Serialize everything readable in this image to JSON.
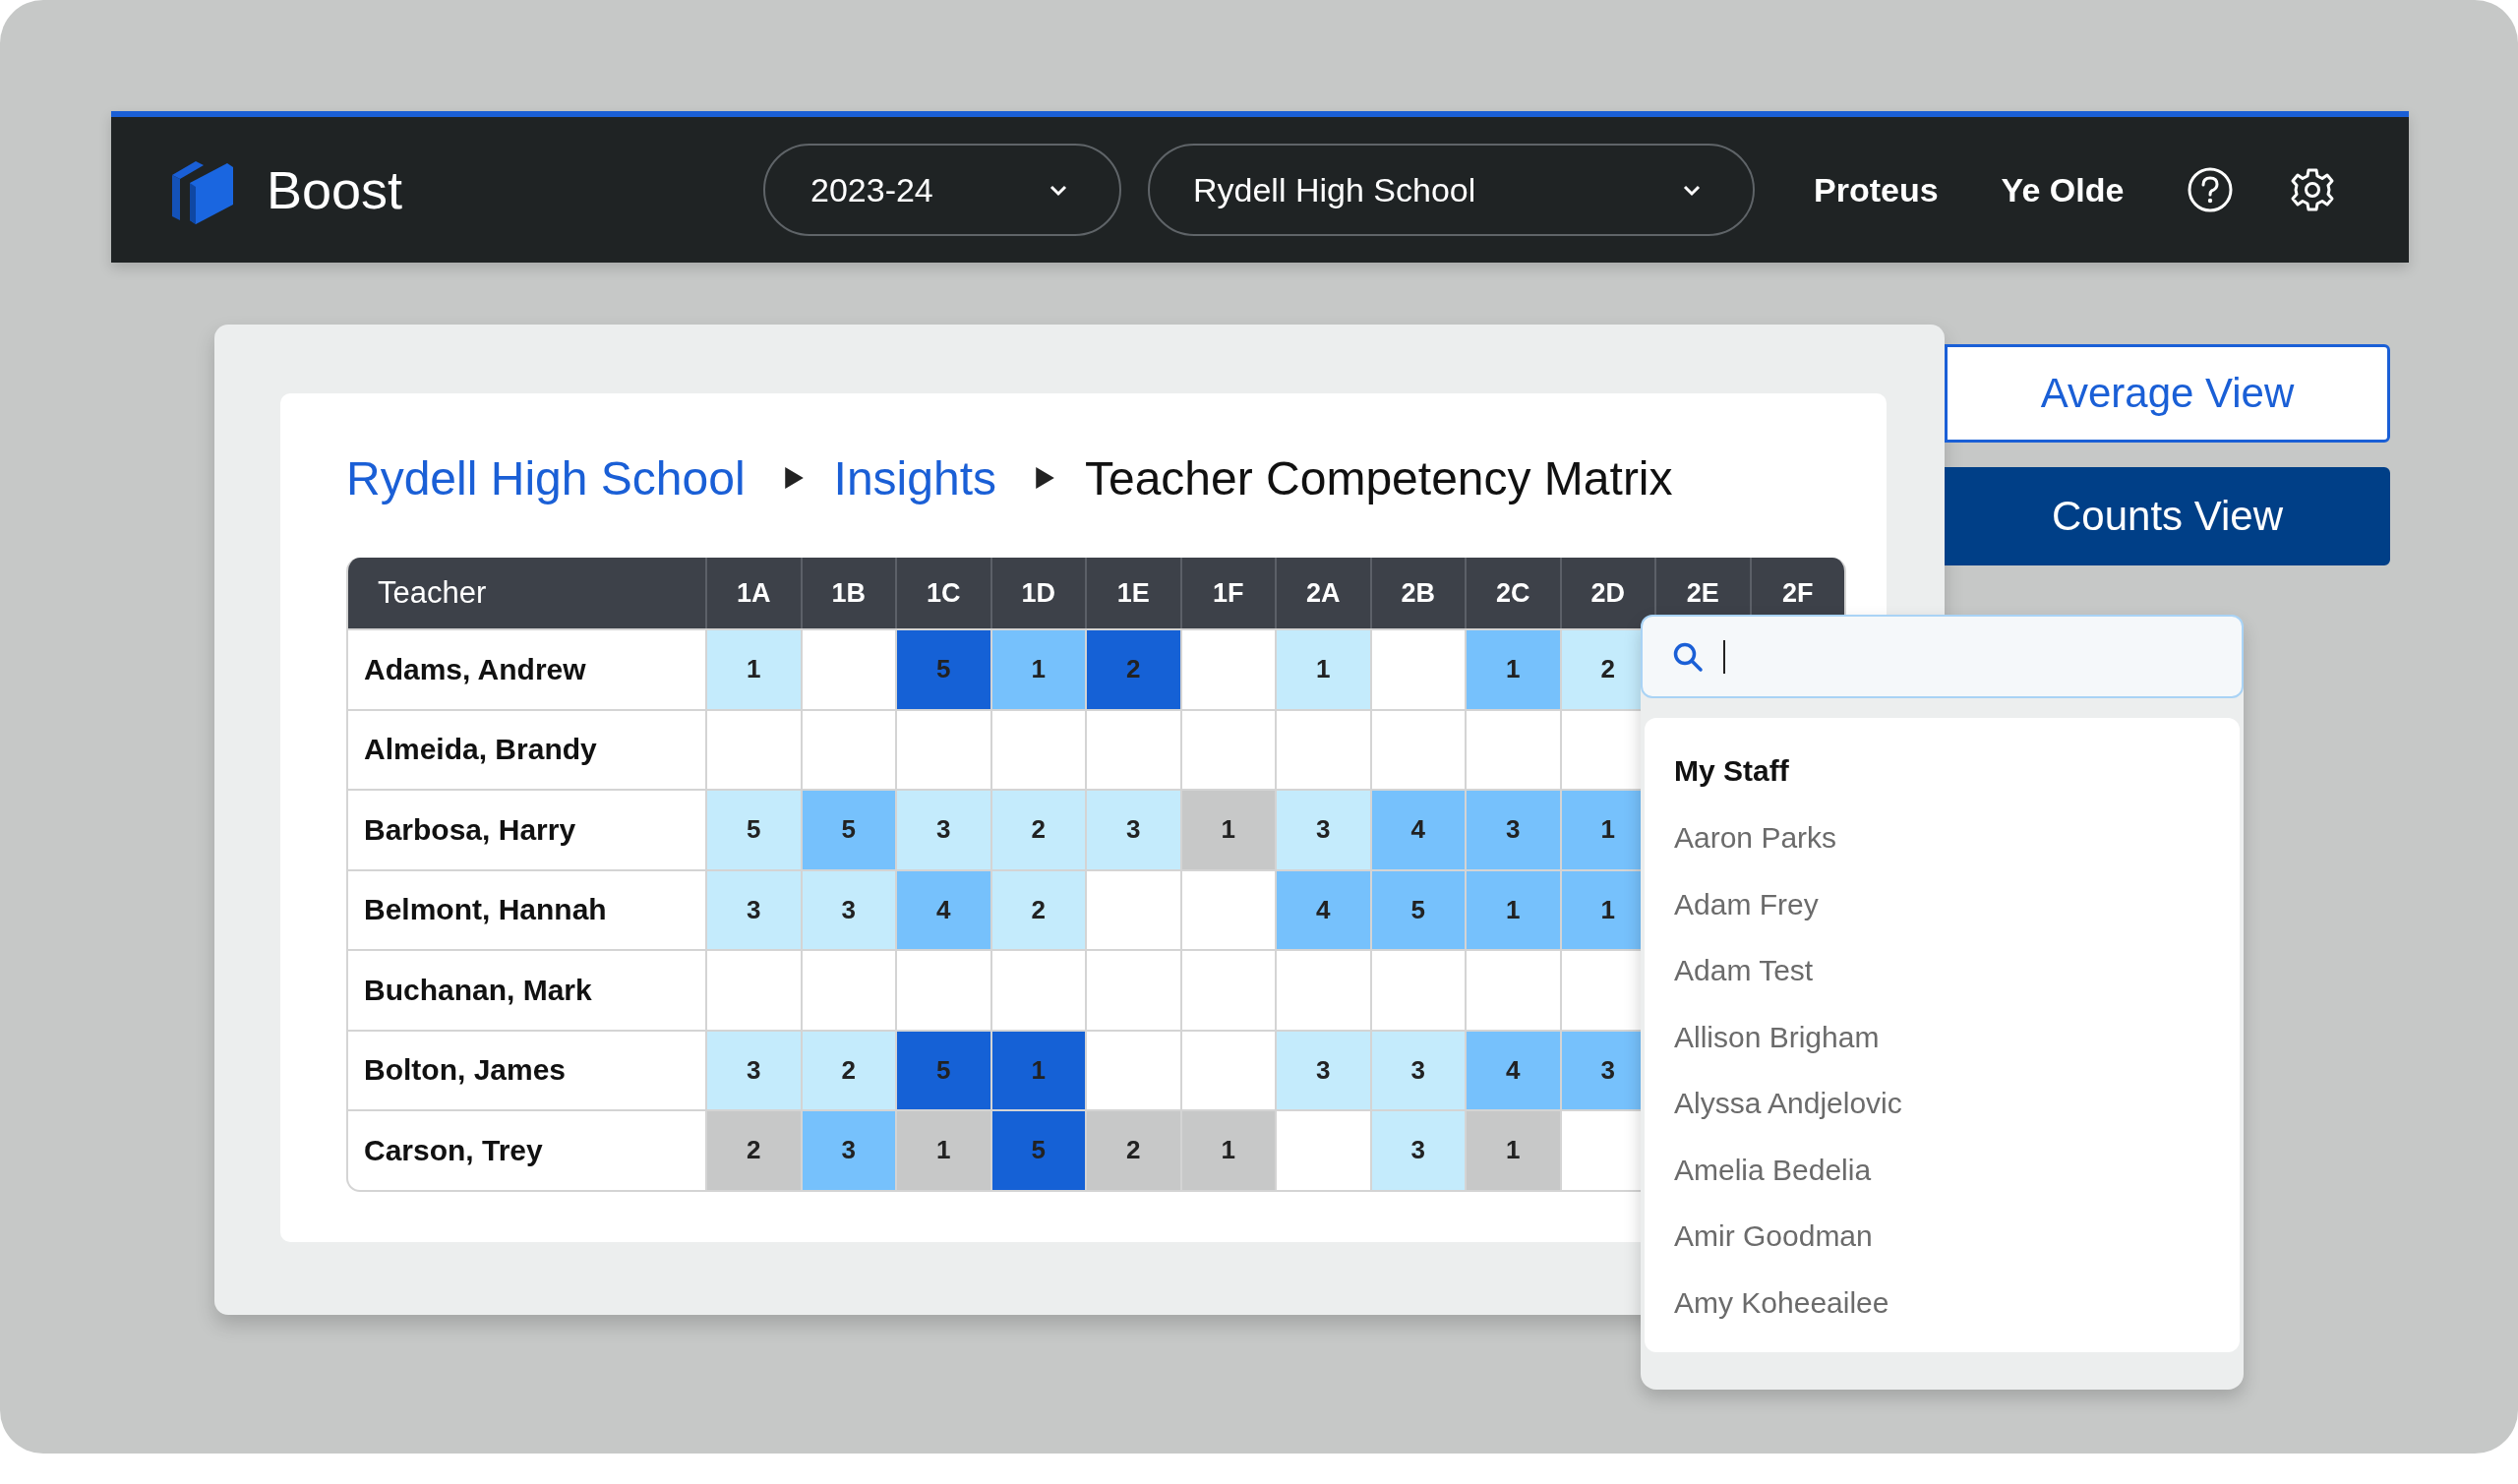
{
  "header": {
    "brand": "Boost",
    "year_select": "2023-24",
    "school_select": "Rydell High School",
    "links": [
      "Proteus",
      "Ye Olde"
    ]
  },
  "breadcrumb": {
    "links": [
      "Rydell High School",
      "Insights"
    ],
    "current": "Teacher Competency Matrix"
  },
  "view_buttons": [
    {
      "label": "Average View",
      "selected": false
    },
    {
      "label": "Counts View",
      "selected": true
    }
  ],
  "matrix": {
    "teacher_header": "Teacher",
    "columns": [
      "1A",
      "1B",
      "1C",
      "1D",
      "1E",
      "1F",
      "2A",
      "2B",
      "2C",
      "2D",
      "2E",
      "2F"
    ],
    "rows": [
      {
        "teacher": "Adams, Andrew",
        "cells": [
          {
            "value": "1",
            "color": "#c4ebfc"
          },
          null,
          {
            "value": "5",
            "color": "#1561d6"
          },
          {
            "value": "1",
            "color": "#76c1fc"
          },
          {
            "value": "2",
            "color": "#1561d6"
          },
          null,
          {
            "value": "1",
            "color": "#c4ebfc"
          },
          null,
          {
            "value": "1",
            "color": "#76c1fc"
          },
          {
            "value": "2",
            "color": "#c4ebfc"
          }
        ]
      },
      {
        "teacher": "Almeida, Brandy",
        "cells": [
          null,
          null,
          null,
          null,
          null,
          null,
          null,
          null,
          null,
          null
        ]
      },
      {
        "teacher": "Barbosa, Harry",
        "cells": [
          {
            "value": "5",
            "color": "#c4ebfc"
          },
          {
            "value": "5",
            "color": "#76c1fc"
          },
          {
            "value": "3",
            "color": "#c4ebfc"
          },
          {
            "value": "2",
            "color": "#c4ebfc"
          },
          {
            "value": "3",
            "color": "#c4ebfc"
          },
          {
            "value": "1",
            "color": "#c7c8c8"
          },
          {
            "value": "3",
            "color": "#c4ebfc"
          },
          {
            "value": "4",
            "color": "#76c1fc"
          },
          {
            "value": "3",
            "color": "#76c1fc"
          },
          {
            "value": "1",
            "color": "#76c1fc"
          }
        ]
      },
      {
        "teacher": "Belmont, Hannah",
        "cells": [
          {
            "value": "3",
            "color": "#c4ebfc"
          },
          {
            "value": "3",
            "color": "#c4ebfc"
          },
          {
            "value": "4",
            "color": "#76c1fc"
          },
          {
            "value": "2",
            "color": "#c4ebfc"
          },
          null,
          null,
          {
            "value": "4",
            "color": "#76c1fc"
          },
          {
            "value": "5",
            "color": "#76c1fc"
          },
          {
            "value": "1",
            "color": "#76c1fc"
          },
          {
            "value": "1",
            "color": "#76c1fc"
          }
        ]
      },
      {
        "teacher": "Buchanan, Mark",
        "cells": [
          null,
          null,
          null,
          null,
          null,
          null,
          null,
          null,
          null,
          null
        ]
      },
      {
        "teacher": "Bolton, James",
        "cells": [
          {
            "value": "3",
            "color": "#c4ebfc"
          },
          {
            "value": "2",
            "color": "#c4ebfc"
          },
          {
            "value": "5",
            "color": "#1561d6"
          },
          {
            "value": "1",
            "color": "#1561d6"
          },
          null,
          null,
          {
            "value": "3",
            "color": "#c4ebfc"
          },
          {
            "value": "3",
            "color": "#c4ebfc"
          },
          {
            "value": "4",
            "color": "#76c1fc"
          },
          {
            "value": "3",
            "color": "#76c1fc"
          }
        ]
      },
      {
        "teacher": "Carson, Trey",
        "cells": [
          {
            "value": "2",
            "color": "#c7c8c8"
          },
          {
            "value": "3",
            "color": "#76c1fc"
          },
          {
            "value": "1",
            "color": "#c7c8c8"
          },
          {
            "value": "5",
            "color": "#1561d6"
          },
          {
            "value": "2",
            "color": "#c7c8c8"
          },
          {
            "value": "1",
            "color": "#c7c8c8"
          },
          null,
          {
            "value": "3",
            "color": "#c4ebfc"
          },
          {
            "value": "1",
            "color": "#c7c8c8"
          },
          null
        ]
      }
    ]
  },
  "staff_dropdown": {
    "heading": "My Staff",
    "items": [
      "Aaron Parks",
      "Adam Frey",
      "Adam Test",
      "Allison Brigham",
      "Alyssa Andjelovic",
      "Amelia Bedelia",
      "Amir Goodman",
      "Amy Koheeailee"
    ]
  }
}
